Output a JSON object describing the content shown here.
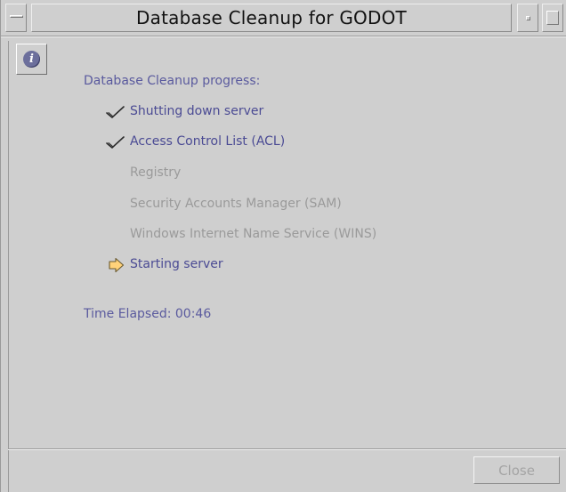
{
  "window": {
    "title": "Database Cleanup for GODOT"
  },
  "content": {
    "heading": "Database Cleanup progress:",
    "steps": [
      {
        "label": "Shutting down server",
        "status": "done",
        "icon": "check-icon"
      },
      {
        "label": "Access Control List (ACL)",
        "status": "done",
        "icon": "check-icon"
      },
      {
        "label": "Registry",
        "status": "pending",
        "icon": ""
      },
      {
        "label": "Security Accounts Manager (SAM)",
        "status": "pending",
        "icon": ""
      },
      {
        "label": "Windows Internet Name Service (WINS)",
        "status": "pending",
        "icon": ""
      },
      {
        "label": "Starting server",
        "status": "active",
        "icon": "arrow-right-icon"
      }
    ],
    "elapsed": "Time Elapsed: 00:46"
  },
  "buttons": {
    "close_label": "Close",
    "close_enabled": false
  },
  "colors": {
    "background": "#cfcfcf",
    "accent_text": "#4b4b94",
    "disabled_text": "#9a9a9a",
    "arrow_fill": "#ffd27a",
    "info_icon": "#6c6f9c"
  }
}
